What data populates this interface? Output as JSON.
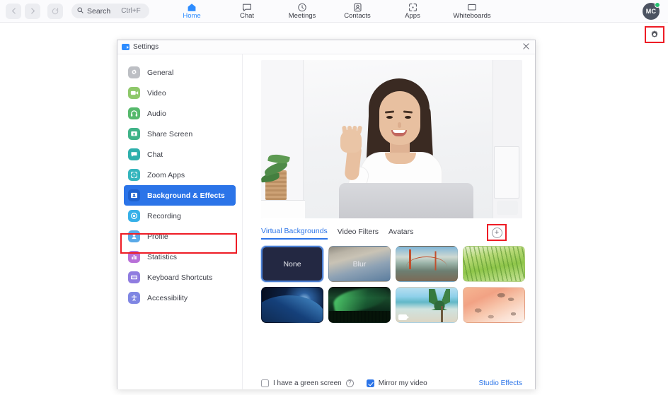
{
  "topbar": {
    "back_icon": "chevron-left-icon",
    "forward_icon": "chevron-right-icon",
    "history_icon": "history-icon",
    "search": {
      "label": "Search",
      "shortcut": "Ctrl+F",
      "icon": "search-icon"
    },
    "nav": [
      {
        "label": "Home",
        "icon": "home-icon",
        "active": true
      },
      {
        "label": "Chat",
        "icon": "chat-bubble-icon",
        "active": false
      },
      {
        "label": "Meetings",
        "icon": "clock-icon",
        "active": false
      },
      {
        "label": "Contacts",
        "icon": "contacts-icon",
        "active": false
      },
      {
        "label": "Apps",
        "icon": "apps-icon",
        "active": false
      },
      {
        "label": "Whiteboards",
        "icon": "whiteboard-icon",
        "active": false
      }
    ],
    "avatar": {
      "initials": "MC",
      "status": "available",
      "status_color": "#25c16f"
    },
    "settings_gear": {
      "icon": "gear-icon",
      "annotated": true,
      "annotation_color": "#ee1c25"
    }
  },
  "dialog": {
    "title": "Settings",
    "logo_icon": "zoom-logo-icon",
    "close_icon": "close-icon",
    "sidebar": [
      {
        "label": "General",
        "icon": "gear-icon",
        "color": "#bdbfc4",
        "selected": false
      },
      {
        "label": "Video",
        "icon": "video-camera-icon",
        "color": "#8ec86a",
        "selected": false
      },
      {
        "label": "Audio",
        "icon": "headphones-icon",
        "color": "#56b96c",
        "selected": false
      },
      {
        "label": "Share Screen",
        "icon": "share-screen-icon",
        "color": "#3fb388",
        "selected": false
      },
      {
        "label": "Chat",
        "icon": "chat-bubble-icon",
        "color": "#2eb0ac",
        "selected": false
      },
      {
        "label": "Zoom Apps",
        "icon": "zoom-apps-icon",
        "color": "#34b5bd",
        "selected": false
      },
      {
        "label": "Background & Effects",
        "icon": "background-effects-icon",
        "color": "#2b74e8",
        "selected": true
      },
      {
        "label": "Recording",
        "icon": "record-icon",
        "color": "#36b0e8",
        "selected": false
      },
      {
        "label": "Profile",
        "icon": "person-icon",
        "color": "#59a9e8",
        "selected": false
      },
      {
        "label": "Statistics",
        "icon": "bar-chart-icon",
        "color": "#b870d8",
        "selected": false
      },
      {
        "label": "Keyboard Shortcuts",
        "icon": "keyboard-icon",
        "color": "#8f7ce0",
        "selected": false
      },
      {
        "label": "Accessibility",
        "icon": "accessibility-icon",
        "color": "#7f86e3",
        "selected": false
      }
    ],
    "preview": {
      "name": "video-preview",
      "description": "Self-view video preview"
    },
    "tabs": [
      {
        "label": "Virtual Backgrounds",
        "active": true
      },
      {
        "label": "Video Filters",
        "active": false
      },
      {
        "label": "Avatars",
        "active": false
      }
    ],
    "add_button": {
      "label": "+",
      "icon": "plus-circle-icon",
      "annotated": true,
      "annotation_color": "#ee1c25"
    },
    "backgrounds": [
      {
        "label": "None",
        "style": "bg-none",
        "selected": true,
        "video": false
      },
      {
        "label": "Blur",
        "style": "bg-blur",
        "selected": false,
        "video": false
      },
      {
        "label": "",
        "style": "bg-bridge",
        "selected": false,
        "video": false
      },
      {
        "label": "",
        "style": "bg-grass",
        "selected": false,
        "video": false
      },
      {
        "label": "",
        "style": "bg-earth",
        "selected": false,
        "video": false
      },
      {
        "label": "",
        "style": "bg-aurora",
        "selected": false,
        "video": true
      },
      {
        "label": "",
        "style": "bg-beach",
        "selected": false,
        "video": true
      },
      {
        "label": "",
        "style": "bg-coral",
        "selected": false,
        "video": false
      }
    ],
    "options": {
      "green_screen": {
        "label": "I have a green screen",
        "checked": false,
        "help_icon": "question-mark-icon",
        "help_glyph": "?"
      },
      "mirror_video": {
        "label": "Mirror my video",
        "checked": true
      },
      "studio_effects": {
        "label": "Studio Effects"
      }
    }
  }
}
